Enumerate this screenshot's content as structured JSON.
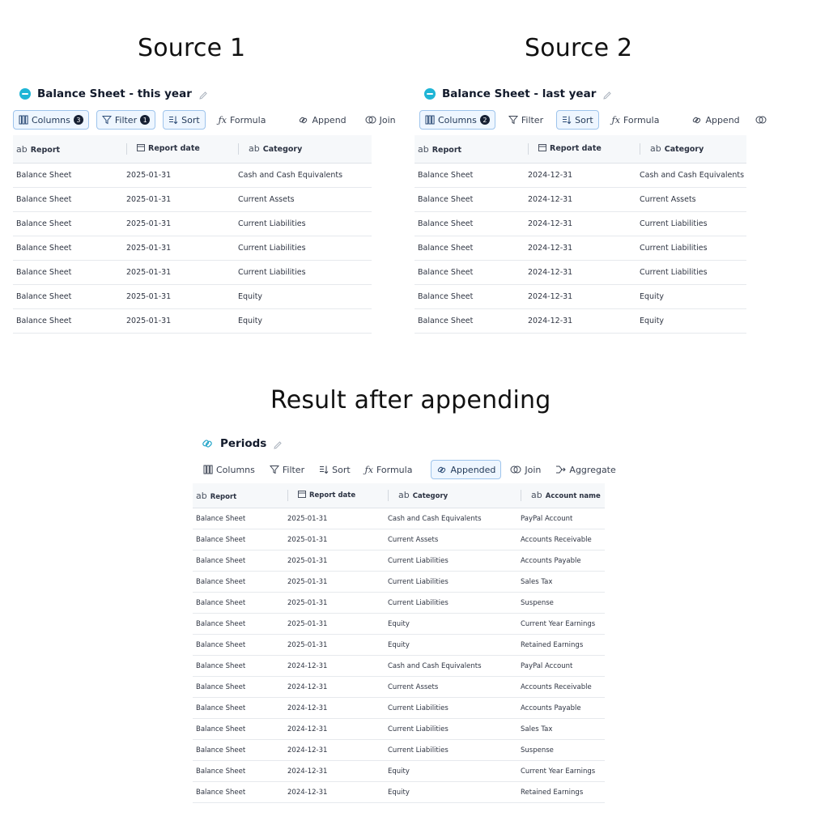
{
  "headings": {
    "source1": "Source 1",
    "source2": "Source 2",
    "result": "Result after appending"
  },
  "panel1": {
    "title": "Balance Sheet - this year",
    "toolbar": {
      "columns": "Columns",
      "columns_count": "3",
      "filter": "Filter",
      "filter_count": "1",
      "sort": "Sort",
      "formula": "Formula",
      "append": "Append",
      "join": "Join"
    },
    "columns": [
      "Report",
      "Report date",
      "Category"
    ],
    "rows": [
      [
        "Balance Sheet",
        "2025-01-31",
        "Cash and Cash Equivalents"
      ],
      [
        "Balance Sheet",
        "2025-01-31",
        "Current Assets"
      ],
      [
        "Balance Sheet",
        "2025-01-31",
        "Current Liabilities"
      ],
      [
        "Balance Sheet",
        "2025-01-31",
        "Current Liabilities"
      ],
      [
        "Balance Sheet",
        "2025-01-31",
        "Current Liabilities"
      ],
      [
        "Balance Sheet",
        "2025-01-31",
        "Equity"
      ],
      [
        "Balance Sheet",
        "2025-01-31",
        "Equity"
      ]
    ]
  },
  "panel2": {
    "title": "Balance Sheet - last year",
    "toolbar": {
      "columns": "Columns",
      "columns_count": "2",
      "filter": "Filter",
      "sort": "Sort",
      "formula": "Formula",
      "append": "Append"
    },
    "columns": [
      "Report",
      "Report date",
      "Category"
    ],
    "rows": [
      [
        "Balance Sheet",
        "2024-12-31",
        "Cash and Cash Equivalents"
      ],
      [
        "Balance Sheet",
        "2024-12-31",
        "Current Assets"
      ],
      [
        "Balance Sheet",
        "2024-12-31",
        "Current Liabilities"
      ],
      [
        "Balance Sheet",
        "2024-12-31",
        "Current Liabilities"
      ],
      [
        "Balance Sheet",
        "2024-12-31",
        "Current Liabilities"
      ],
      [
        "Balance Sheet",
        "2024-12-31",
        "Equity"
      ],
      [
        "Balance Sheet",
        "2024-12-31",
        "Equity"
      ]
    ]
  },
  "panel3": {
    "title": "Periods",
    "toolbar": {
      "columns": "Columns",
      "filter": "Filter",
      "sort": "Sort",
      "formula": "Formula",
      "appended": "Appended",
      "join": "Join",
      "aggregate": "Aggregate"
    },
    "columns": [
      "Report",
      "Report date",
      "Category",
      "Account name"
    ],
    "rows": [
      [
        "Balance Sheet",
        "2025-01-31",
        "Cash and Cash Equivalents",
        "PayPal Account"
      ],
      [
        "Balance Sheet",
        "2025-01-31",
        "Current Assets",
        "Accounts Receivable"
      ],
      [
        "Balance Sheet",
        "2025-01-31",
        "Current Liabilities",
        "Accounts Payable"
      ],
      [
        "Balance Sheet",
        "2025-01-31",
        "Current Liabilities",
        "Sales Tax"
      ],
      [
        "Balance Sheet",
        "2025-01-31",
        "Current Liabilities",
        "Suspense"
      ],
      [
        "Balance Sheet",
        "2025-01-31",
        "Equity",
        "Current Year Earnings"
      ],
      [
        "Balance Sheet",
        "2025-01-31",
        "Equity",
        "Retained Earnings"
      ],
      [
        "Balance Sheet",
        "2024-12-31",
        "Cash and Cash Equivalents",
        "PayPal Account"
      ],
      [
        "Balance Sheet",
        "2024-12-31",
        "Current Assets",
        "Accounts Receivable"
      ],
      [
        "Balance Sheet",
        "2024-12-31",
        "Current Liabilities",
        "Accounts Payable"
      ],
      [
        "Balance Sheet",
        "2024-12-31",
        "Current Liabilities",
        "Sales Tax"
      ],
      [
        "Balance Sheet",
        "2024-12-31",
        "Current Liabilities",
        "Suspense"
      ],
      [
        "Balance Sheet",
        "2024-12-31",
        "Equity",
        "Current Year Earnings"
      ],
      [
        "Balance Sheet",
        "2024-12-31",
        "Equity",
        "Retained Earnings"
      ]
    ]
  },
  "icons": {
    "text_type": "ab",
    "date_type": "calendar-icon",
    "brand": "logo-dot",
    "edit": "pencil-icon"
  },
  "colors": {
    "active_bg": "#eef6ff",
    "active_border": "#9ec4ec",
    "brand": "#1fb5d6",
    "badge": "#162033"
  }
}
